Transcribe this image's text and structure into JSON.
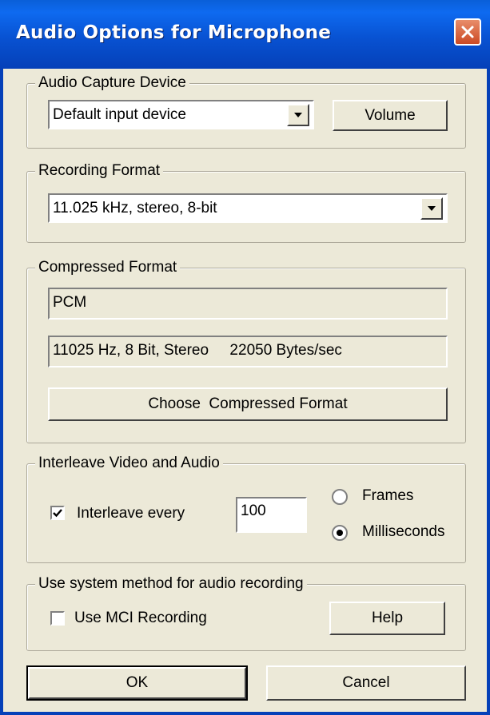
{
  "window": {
    "title": "Audio Options for Microphone"
  },
  "capture_group": {
    "legend": "Audio Capture Device",
    "device_value": "Default input device",
    "volume_label": "Volume"
  },
  "recording_group": {
    "legend": "Recording Format",
    "format_value": "11.025 kHz, stereo, 8-bit"
  },
  "compressed_group": {
    "legend": "Compressed Format",
    "codec": "PCM",
    "details": "11025 Hz, 8 Bit, Stereo     22050 Bytes/sec",
    "choose_label": "Choose  Compressed Format"
  },
  "interleave_group": {
    "legend": "Interleave Video and Audio",
    "checkbox_label": "Interleave every",
    "checked": true,
    "value": "100",
    "radio_frames": "Frames",
    "radio_ms": "Milliseconds",
    "selected_unit": "Milliseconds"
  },
  "system_group": {
    "legend": "Use system method for audio recording",
    "mci_label": "Use MCI Recording",
    "mci_checked": false,
    "help_label": "Help"
  },
  "footer": {
    "ok_label": "OK",
    "cancel_label": "Cancel"
  },
  "colors": {
    "titlebar": "#0852D2",
    "face": "#ECE9D8",
    "close": "#CC4A24"
  }
}
